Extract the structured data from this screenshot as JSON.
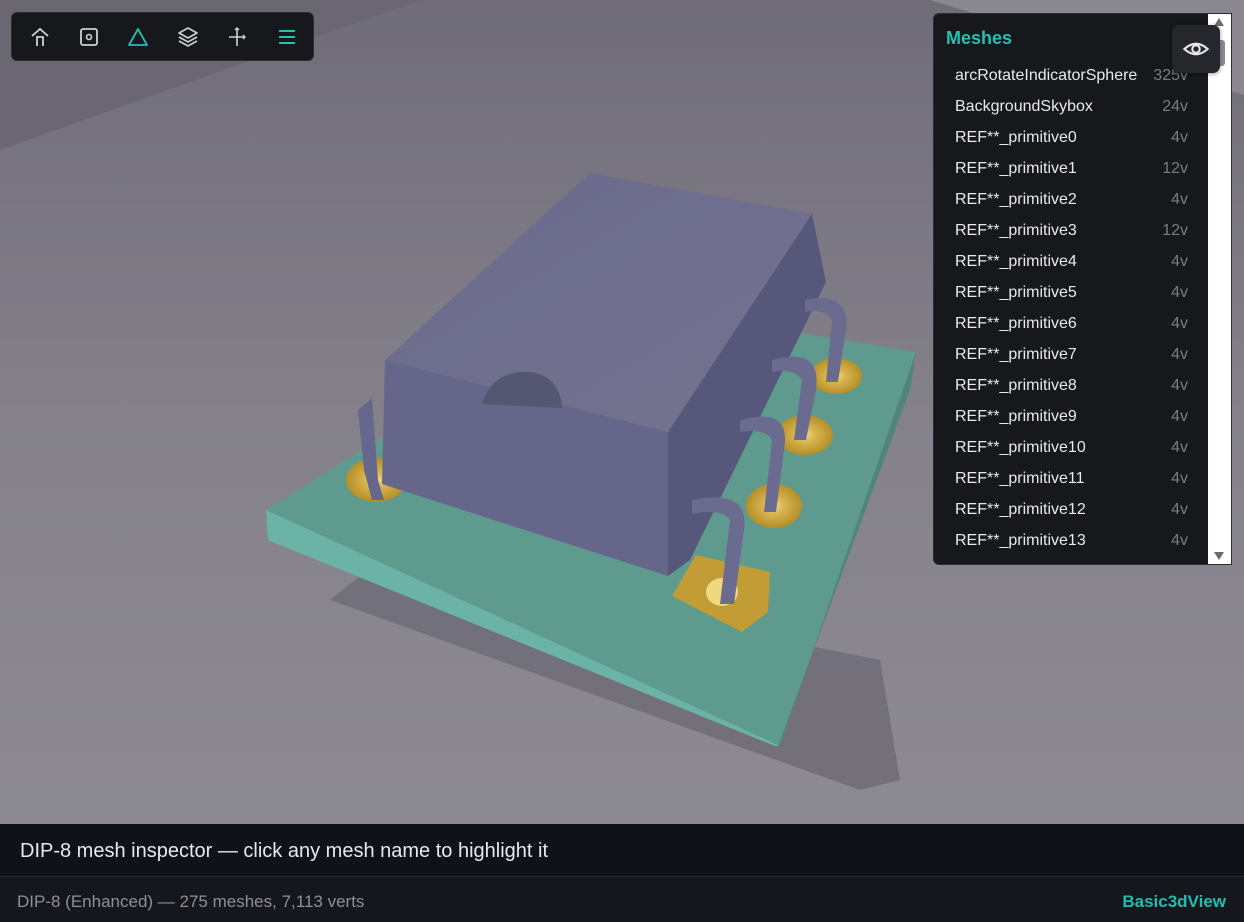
{
  "toolbar": {
    "tools": [
      {
        "name": "home-icon",
        "active": false
      },
      {
        "name": "focus-icon",
        "active": false
      },
      {
        "name": "triangle-icon",
        "active": true
      },
      {
        "name": "layers-icon",
        "active": false
      },
      {
        "name": "axes-icon",
        "active": false
      },
      {
        "name": "menu-icon",
        "active": true
      }
    ]
  },
  "meshes": {
    "title": "Meshes",
    "items": [
      {
        "name": "arcRotateIndicatorSphere",
        "verts": "325v"
      },
      {
        "name": "BackgroundSkybox",
        "verts": "24v"
      },
      {
        "name": "REF**_primitive0",
        "verts": "4v"
      },
      {
        "name": "REF**_primitive1",
        "verts": "12v"
      },
      {
        "name": "REF**_primitive2",
        "verts": "4v"
      },
      {
        "name": "REF**_primitive3",
        "verts": "12v"
      },
      {
        "name": "REF**_primitive4",
        "verts": "4v"
      },
      {
        "name": "REF**_primitive5",
        "verts": "4v"
      },
      {
        "name": "REF**_primitive6",
        "verts": "4v"
      },
      {
        "name": "REF**_primitive7",
        "verts": "4v"
      },
      {
        "name": "REF**_primitive8",
        "verts": "4v"
      },
      {
        "name": "REF**_primitive9",
        "verts": "4v"
      },
      {
        "name": "REF**_primitive10",
        "verts": "4v"
      },
      {
        "name": "REF**_primitive11",
        "verts": "4v"
      },
      {
        "name": "REF**_primitive12",
        "verts": "4v"
      },
      {
        "name": "REF**_primitive13",
        "verts": "4v"
      }
    ]
  },
  "visibility_toggle": {
    "icon": "eye-icon"
  },
  "caption": "DIP-8 mesh inspector — click any mesh name to highlight it",
  "status": {
    "text": "DIP-8 (Enhanced) — 275 meshes, 7,113 verts",
    "brand": "Basic3dView"
  },
  "colors": {
    "accent": "#26bfb3",
    "panel_bg": "#17181c",
    "chip_body": "#6e6d91",
    "pcb": "#5f9a8e",
    "pad": "#c9a43a"
  }
}
